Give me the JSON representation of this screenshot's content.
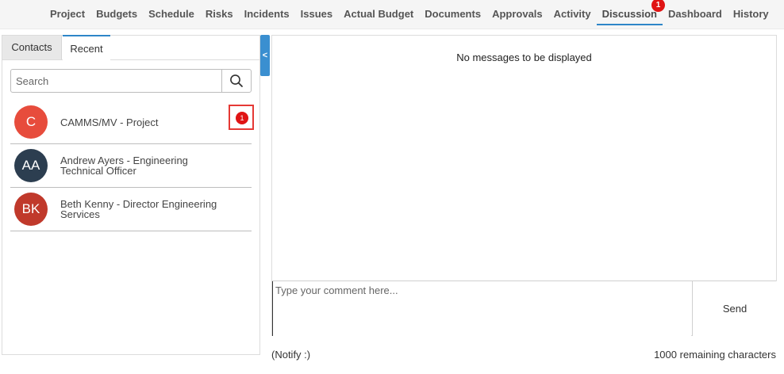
{
  "nav": {
    "tabs": [
      {
        "label": "Project"
      },
      {
        "label": "Budgets"
      },
      {
        "label": "Schedule"
      },
      {
        "label": "Risks"
      },
      {
        "label": "Incidents"
      },
      {
        "label": "Issues"
      },
      {
        "label": "Actual Budget"
      },
      {
        "label": "Documents"
      },
      {
        "label": "Approvals"
      },
      {
        "label": "Activity"
      },
      {
        "label": "Discussion",
        "badge": "1",
        "active": true
      },
      {
        "label": "Dashboard"
      },
      {
        "label": "History"
      }
    ]
  },
  "left_panel": {
    "tabs": {
      "contacts": "Contacts",
      "recent": "Recent"
    },
    "search": {
      "placeholder": "Search"
    },
    "contacts": [
      {
        "initials": "C",
        "name": "CAMMS/MV - Project",
        "avatar_color": "#e74c3c",
        "unread": "1"
      },
      {
        "initials": "AA",
        "name": "Andrew Ayers - Engineering Technical Officer",
        "avatar_color": "#2c3e50"
      },
      {
        "initials": "BK",
        "name": "Beth Kenny - Director Engineering Services",
        "avatar_color": "#c0392b"
      }
    ]
  },
  "collapse_label": "<",
  "messages": {
    "empty_text": "No messages to be displayed"
  },
  "composer": {
    "placeholder": "Type your comment here...",
    "send_label": "Send",
    "notify_label": "(Notify :)",
    "remaining_label": "1000 remaining characters"
  }
}
